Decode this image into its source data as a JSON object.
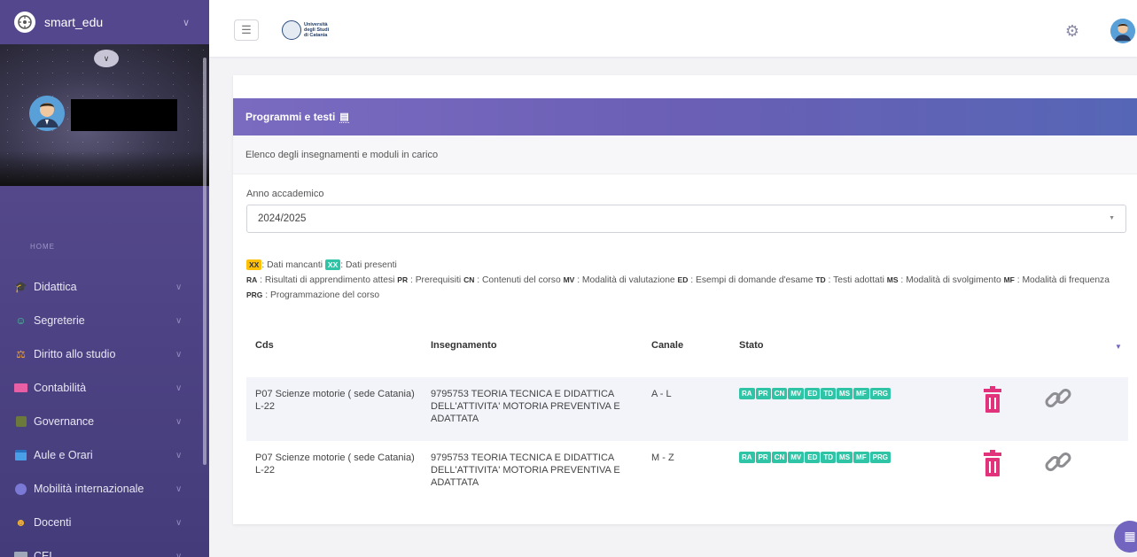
{
  "sidebar": {
    "brand": "smart_edu",
    "section_label": "HOME",
    "items": [
      {
        "label": "Didattica",
        "icon": "graduation-cap-icon",
        "color": "#8fb3d9"
      },
      {
        "label": "Segreterie",
        "icon": "users-icon",
        "color": "#4fc3a1"
      },
      {
        "label": "Diritto allo studio",
        "icon": "scale-icon",
        "color": "#f0a030"
      },
      {
        "label": "Contabilità",
        "icon": "card-icon",
        "color": "#e85fa6"
      },
      {
        "label": "Governance",
        "icon": "governance-icon",
        "color": "#6b7a3a"
      },
      {
        "label": "Aule e Orari",
        "icon": "calendar-icon",
        "color": "#4aa0e8"
      },
      {
        "label": "Mobilità internazionale",
        "icon": "globe-icon",
        "color": "#7b79d6"
      },
      {
        "label": "Docenti",
        "icon": "teacher-icon",
        "color": "#f0b030"
      },
      {
        "label": "CEL",
        "icon": "cel-icon",
        "color": "#9fa7b8"
      }
    ]
  },
  "topbar": {
    "university_logo_text": [
      "Università",
      "degli Studi",
      "di Catania"
    ]
  },
  "panel": {
    "title": "Programmi e testi",
    "description": "Elenco degli insegnamenti e moduli in carico",
    "year_label": "Anno accademico",
    "year_value": "2024/2025"
  },
  "legend": {
    "missing_badge": "XX",
    "missing_text": ": Dati mancanti",
    "present_badge": "XX",
    "present_text": ": Dati presenti",
    "entries": [
      {
        "code": "RA",
        "text": ": Risultati di apprendimento attesi"
      },
      {
        "code": "PR",
        "text": ": Prerequisiti"
      },
      {
        "code": "CN",
        "text": ": Contenuti del corso"
      },
      {
        "code": "MV",
        "text": ": Modalità di valutazione"
      },
      {
        "code": "ED",
        "text": ": Esempi di domande d'esame"
      },
      {
        "code": "TD",
        "text": ": Testi adottati"
      },
      {
        "code": "MS",
        "text": ": Modalità di svolgimento"
      },
      {
        "code": "MF",
        "text": ": Modalità di frequenza"
      },
      {
        "code": "PRG",
        "text": ": Programmazione del corso"
      }
    ]
  },
  "table": {
    "headers": {
      "cds": "Cds",
      "insegnamento": "Insegnamento",
      "canale": "Canale",
      "stato": "Stato"
    },
    "rows": [
      {
        "cds": "P07 Scienze motorie ( sede Catania) L-22",
        "insegnamento": "9795753 TEORIA TECNICA E DIDATTICA DELL'ATTIVITA' MOTORIA PREVENTIVA E ADATTATA",
        "canale": "A - L",
        "stato": [
          "RA",
          "PR",
          "CN",
          "MV",
          "ED",
          "TD",
          "MS",
          "MF",
          "PRG"
        ]
      },
      {
        "cds": "P07 Scienze motorie ( sede Catania) L-22",
        "insegnamento": "9795753 TEORIA TECNICA E DIDATTICA DELL'ATTIVITA' MOTORIA PREVENTIVA E ADATTATA",
        "canale": "M - Z",
        "stato": [
          "RA",
          "PR",
          "CN",
          "MV",
          "ED",
          "TD",
          "MS",
          "MF",
          "PRG"
        ]
      }
    ]
  },
  "colors": {
    "accent": "#7165c0",
    "present": "#2ec4a5",
    "missing": "#ffc107",
    "trash": "#e3327c",
    "link": "#8e8e92"
  }
}
